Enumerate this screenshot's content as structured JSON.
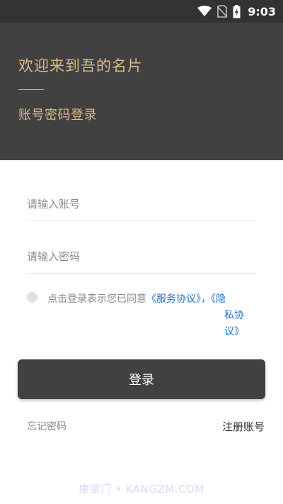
{
  "status_bar": {
    "time": "9:03",
    "icons": [
      "wifi-icon",
      "no-sim-icon",
      "battery-charging-icon"
    ]
  },
  "header": {
    "title": "欢迎来到吾的名片",
    "subtitle": "账号密码登录"
  },
  "form": {
    "account_placeholder": "请输入账号",
    "password_placeholder": "请输入密码",
    "agreement": {
      "prefix": "点击登录表示您已同意",
      "service_link": "《服务协议》",
      "separator": "，",
      "privacy_link_part1": "《隐",
      "privacy_link_part2": "私协",
      "privacy_link_part3": "议》"
    },
    "login_label": "登录",
    "forgot_label": "忘记密码",
    "register_label": "注册账号"
  },
  "watermark": "康掌门 • KANGZM.COM",
  "colors": {
    "header_bg": "#414141",
    "accent_gold": "#dbb88a",
    "link_blue": "#1f73c4",
    "button_bg": "#414141"
  }
}
